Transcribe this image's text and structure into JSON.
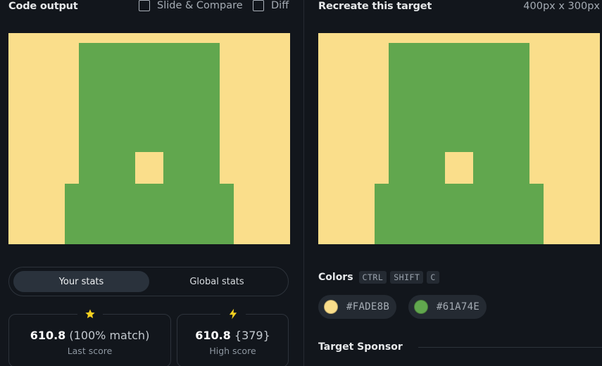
{
  "left_header": {
    "title": "Code output",
    "slide_compare_label": "Slide & Compare",
    "diff_label": "Diff"
  },
  "right_header": {
    "title": "Recreate this target",
    "dimensions": "400px x 300px"
  },
  "canvas_colors": {
    "background": "#FADE8B",
    "shape": "#61A74E"
  },
  "stats": {
    "tab_your": "Your stats",
    "tab_global": "Global stats",
    "last_score": {
      "value": "610.8",
      "detail": "(100% match)",
      "label": "Last score",
      "icon": "star-icon"
    },
    "high_score": {
      "value": "610.8",
      "detail": "{379}",
      "label": "High score",
      "icon": "lightning-icon"
    }
  },
  "colors_section": {
    "title": "Colors",
    "shortcut_keys": [
      "CTRL",
      "SHIFT",
      "C"
    ],
    "swatches": [
      {
        "hex": "#FADE8B",
        "color": "#FADE8B"
      },
      {
        "hex": "#61A74E",
        "color": "#61A74E"
      }
    ]
  },
  "sponsor": {
    "title": "Target Sponsor"
  }
}
